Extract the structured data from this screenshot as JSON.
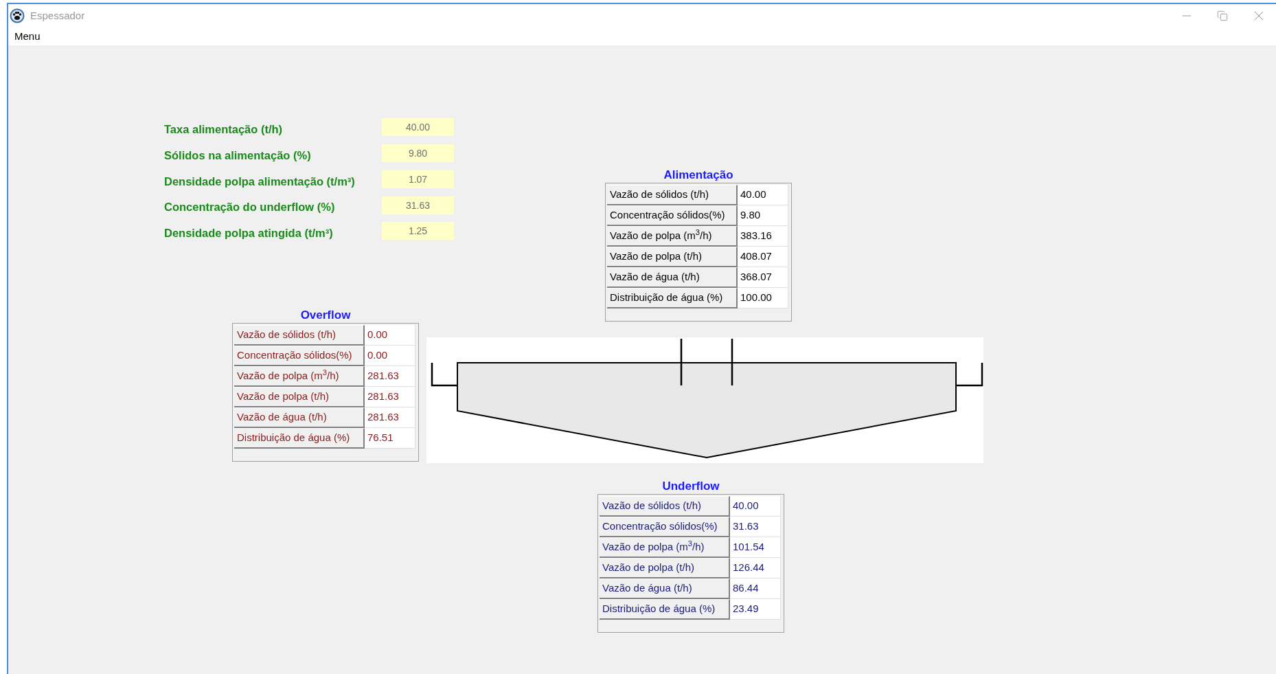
{
  "window": {
    "title": "Espessador"
  },
  "menu": [
    "Menu"
  ],
  "inputs": [
    {
      "label": "Taxa alimentação (t/h)",
      "value": "40.00"
    },
    {
      "label": "Sólidos na alimentação (%)",
      "value": "9.80"
    },
    {
      "label": "Densidade polpa alimentação (t/m³)",
      "value": "1.07"
    },
    {
      "label": "Concentração do underflow (%)",
      "value": "31.63"
    },
    {
      "label": "Densidade polpa atingida (t/m³)",
      "value": "1.25"
    }
  ],
  "sections": [
    {
      "kind": "feed",
      "title": "Alimentação",
      "color": "#000000",
      "rows": [
        {
          "label": "Vazão de sólidos (t/h)",
          "value": "40.00"
        },
        {
          "label": "Concentração sólidos(%)",
          "value": "9.80"
        },
        {
          "label": "Vazão de polpa (m$^{3}$/h)",
          "value": "383.16"
        },
        {
          "label": "Vazão de polpa (t/h)",
          "value": "408.07"
        },
        {
          "label": "Vazão de água (t/h)",
          "value": "368.07"
        },
        {
          "label": "Distribuição de água (%)",
          "value": "100.00"
        }
      ]
    },
    {
      "kind": "overflow",
      "title": "Overflow",
      "color": "#8b1a1a",
      "rows": [
        {
          "label": "Vazão de sólidos (t/h)",
          "value": "0.00"
        },
        {
          "label": "Concentração sólidos(%)",
          "value": "0.00"
        },
        {
          "label": "Vazão de polpa (m$^{3}$/h)",
          "value": "281.63"
        },
        {
          "label": "Vazão de polpa (t/h)",
          "value": "281.63"
        },
        {
          "label": "Vazão de água (t/h)",
          "value": "281.63"
        },
        {
          "label": "Distribuição de água (%)",
          "value": "76.51"
        }
      ]
    },
    {
      "kind": "underflow",
      "title": "Underflow",
      "color": "#1c1c78",
      "rows": [
        {
          "label": "Vazão de sólidos (t/h)",
          "value": "40.00"
        },
        {
          "label": "Concentração sólidos(%)",
          "value": "31.63"
        },
        {
          "label": "Vazão de polpa (m$^{3}$/h)",
          "value": "101.54"
        },
        {
          "label": "Vazão de polpa (t/h)",
          "value": "126.44"
        },
        {
          "label": "Vazão de água (t/h)",
          "value": "86.44"
        },
        {
          "label": "Distribuição de água (%)",
          "value": "23.49"
        }
      ]
    }
  ]
}
